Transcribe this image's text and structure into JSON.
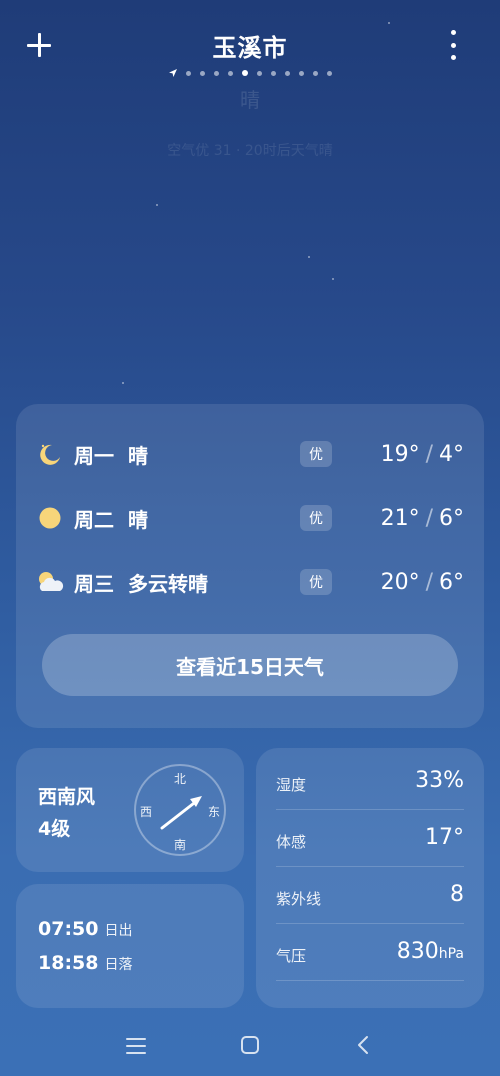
{
  "header": {
    "city": "玉溪市",
    "pages_before": 4,
    "pages_after": 6
  },
  "current": {
    "condition": "晴",
    "faded_line": "空气优 31 · 20时后天气晴"
  },
  "forecast": [
    {
      "day": "周一",
      "condition": "晴",
      "aqi": "优",
      "high": "19°",
      "low": "4°",
      "icon": "moon-icon"
    },
    {
      "day": "周二",
      "condition": "晴",
      "aqi": "优",
      "high": "21°",
      "low": "6°",
      "icon": "sun-icon"
    },
    {
      "day": "周三",
      "condition": "多云转晴",
      "aqi": "优",
      "high": "20°",
      "low": "6°",
      "icon": "partly-cloudy-icon"
    }
  ],
  "forecast_button": "查看近15日天气",
  "wind": {
    "direction": "西南风",
    "level": "4级",
    "compass": {
      "n": "北",
      "s": "南",
      "w": "西",
      "e": "东"
    }
  },
  "sun": {
    "sunrise_time": "07:50",
    "sunrise_label": "日出",
    "sunset_time": "18:58",
    "sunset_label": "日落"
  },
  "details": {
    "humidity_label": "湿度",
    "humidity": "33%",
    "feels_label": "体感",
    "feels": "17°",
    "uv_label": "紫外线",
    "uv": "8",
    "pressure_label": "气压",
    "pressure": "830",
    "pressure_unit": "hPa"
  },
  "colors": {
    "sun": "#f7d57a",
    "bg_top": "#1f3c78",
    "bg_bottom": "#3b70b6"
  }
}
